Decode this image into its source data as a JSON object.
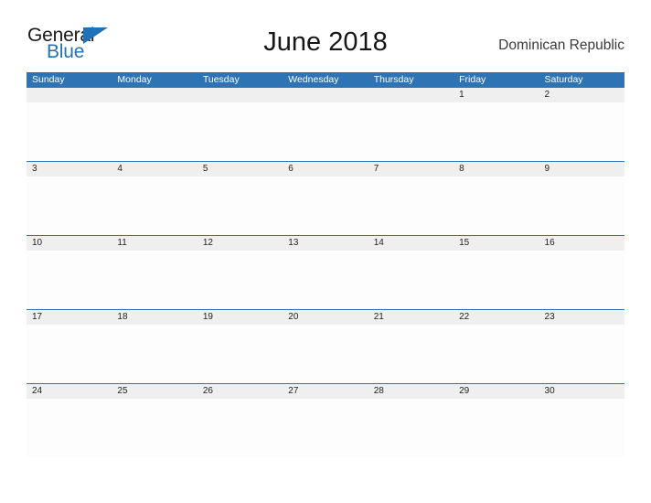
{
  "brand": {
    "name_part1": "General",
    "name_part2": "Blue",
    "triangle_color": "#1f72b8",
    "text_color": "#1a1a1a",
    "accent_color": "#2272b8"
  },
  "header": {
    "title": "June 2018",
    "locale": "Dominican Republic"
  },
  "theme": {
    "header_blue": "#2e74b5",
    "date_band_gray": "#efefef",
    "cell_white": "#fdfdfd",
    "page_background": "#ffffff"
  },
  "calendar": {
    "month": "June",
    "year": "2018",
    "weekdays": [
      "Sunday",
      "Monday",
      "Tuesday",
      "Wednesday",
      "Thursday",
      "Friday",
      "Saturday"
    ],
    "weeks": [
      [
        "",
        "",
        "",
        "",
        "",
        "1",
        "2"
      ],
      [
        "3",
        "4",
        "5",
        "6",
        "7",
        "8",
        "9"
      ],
      [
        "10",
        "11",
        "12",
        "13",
        "14",
        "15",
        "16"
      ],
      [
        "17",
        "18",
        "19",
        "20",
        "21",
        "22",
        "23"
      ],
      [
        "24",
        "25",
        "26",
        "27",
        "28",
        "29",
        "30"
      ]
    ]
  }
}
